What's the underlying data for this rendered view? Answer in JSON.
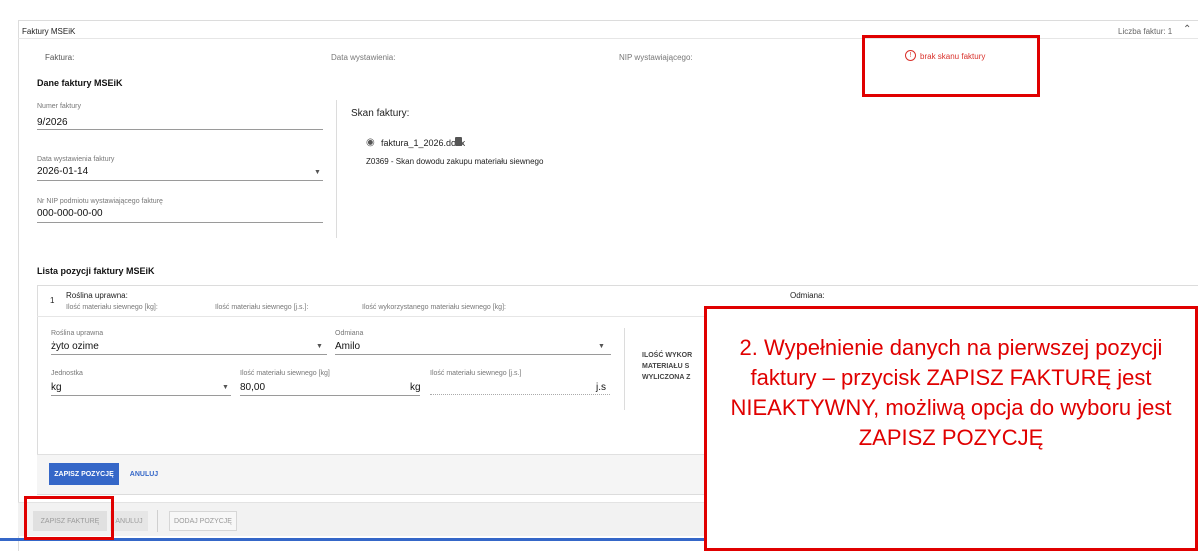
{
  "header": {
    "title": "Faktury MSEiK",
    "count_label": "Liczba faktur: 1"
  },
  "summary": {
    "invoice_label": "Faktura:",
    "date_label": "Data wystawienia:",
    "nip_label": "NIP wystawiającego:",
    "warning_text": "brak skanu faktury"
  },
  "invoice": {
    "section_title": "Dane faktury MSEiK",
    "number_label": "Numer faktury",
    "number_value": "9/2026",
    "date_label": "Data wystawienia faktury",
    "date_value": "2026-01-14",
    "nip_label": "Nr NIP podmiotu wystawiającego fakturę",
    "nip_value": "000-000-00-00"
  },
  "scan": {
    "title": "Skan faktury:",
    "file_name": "faktura_1_2026.docx",
    "description": "Z0369 - Skan dowodu zakupu materiału siewnego"
  },
  "positions": {
    "section_title": "Lista pozycji faktury MSEiK",
    "item_number": "1",
    "crop_header": "Roślina uprawna:",
    "qty_kg_header": "Ilość materiału siewnego [kg]:",
    "qty_js_header": "Ilość materiału siewnego [j.s.]:",
    "qty_used_header": "Ilość wykorzystanego materiału siewnego [kg]:",
    "variety_header": "Odmiana:",
    "form": {
      "crop_label": "Roślina uprawna",
      "crop_value": "żyto ozime",
      "variety_label": "Odmiana",
      "variety_value": "Amilo",
      "unit_label": "Jednostka",
      "unit_value": "kg",
      "qty_kg_label": "Ilość materiału siewnego [kg]",
      "qty_kg_value": "80,00",
      "qty_kg_suffix": "kg",
      "qty_js_label": "Ilość materiału siewnego [j.s.]",
      "qty_js_suffix": "j.s",
      "calc_line1": "ILOŚĆ WYKOR",
      "calc_line2": "MATERIAŁU S",
      "calc_line3": "WYLICZONA Z"
    },
    "save_position_label": "ZAPISZ POZYCJĘ",
    "cancel_label": "ANULUJ"
  },
  "footer": {
    "save_invoice_label": "ZAPISZ FAKTURĘ",
    "cancel_label": "ANULUJ",
    "add_position_label": "DODAJ POZYCJĘ"
  },
  "annotation": {
    "text": "2.   Wypełnienie danych na pierwszej pozycji faktury – przycisk ZAPISZ FAKTURĘ jest NIEAKTYWNY, możliwą opcja do wyboru jest ZAPISZ POZYCJĘ"
  },
  "colors": {
    "primary": "#3567c8",
    "annotation_red": "#e00000",
    "warning_red": "#d9312b"
  }
}
